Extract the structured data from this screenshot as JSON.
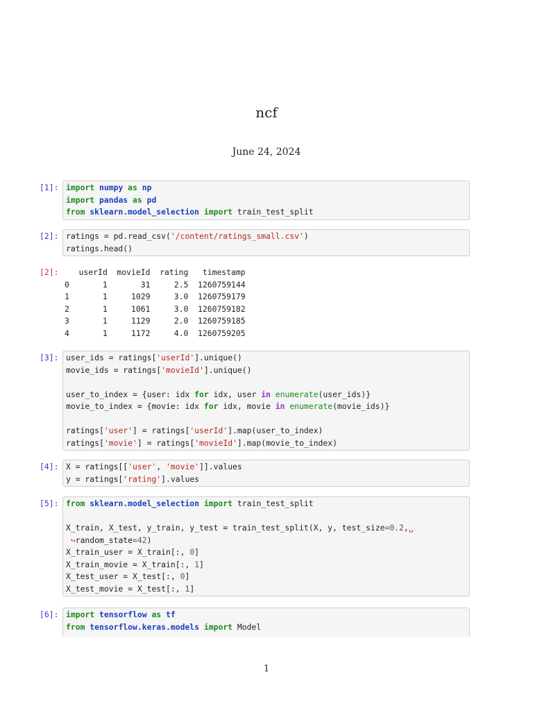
{
  "document": {
    "title": "ncf",
    "date": "June 24, 2024",
    "page_number": "1"
  },
  "cells": [
    {
      "prompt": "[1]:",
      "lines": [
        [
          [
            "import",
            "kw"
          ],
          [
            " ",
            ""
          ],
          [
            "numpy",
            "nn"
          ],
          [
            " ",
            ""
          ],
          [
            "as",
            "kw"
          ],
          [
            " ",
            ""
          ],
          [
            "np",
            "nn"
          ]
        ],
        [
          [
            "import",
            "kw"
          ],
          [
            " ",
            ""
          ],
          [
            "pandas",
            "nn"
          ],
          [
            " ",
            ""
          ],
          [
            "as",
            "kw"
          ],
          [
            " ",
            ""
          ],
          [
            "pd",
            "nn"
          ]
        ],
        [
          [
            "from",
            "kw"
          ],
          [
            " ",
            ""
          ],
          [
            "sklearn.model_selection",
            "nn"
          ],
          [
            " ",
            ""
          ],
          [
            "import",
            "kw"
          ],
          [
            " train_test_split",
            ""
          ]
        ]
      ]
    },
    {
      "prompt": "[2]:",
      "lines": [
        [
          [
            "ratings = pd.read_csv(",
            ""
          ],
          [
            "'/content/ratings_small.csv'",
            "str"
          ],
          [
            ")",
            ""
          ]
        ],
        [
          [
            "ratings.head()",
            ""
          ]
        ]
      ]
    },
    {
      "prompt": "[3]:",
      "lines": [
        [
          [
            "user_ids = ratings[",
            ""
          ],
          [
            "'userId'",
            "str"
          ],
          [
            "].unique()",
            ""
          ]
        ],
        [
          [
            "movie_ids = ratings[",
            ""
          ],
          [
            "'movieId'",
            "str"
          ],
          [
            "].unique()",
            ""
          ]
        ],
        [
          [
            "",
            ""
          ]
        ],
        [
          [
            "user_to_index = {user: idx ",
            ""
          ],
          [
            "for",
            "kw"
          ],
          [
            " idx, user ",
            ""
          ],
          [
            "in",
            "opw"
          ],
          [
            " ",
            ""
          ],
          [
            "enumerate",
            "bi"
          ],
          [
            "(user_ids)}",
            ""
          ]
        ],
        [
          [
            "movie_to_index = {movie: idx ",
            ""
          ],
          [
            "for",
            "kw"
          ],
          [
            " idx, movie ",
            ""
          ],
          [
            "in",
            "opw"
          ],
          [
            " ",
            ""
          ],
          [
            "enumerate",
            "bi"
          ],
          [
            "(movie_ids)}",
            ""
          ]
        ],
        [
          [
            "",
            ""
          ]
        ],
        [
          [
            "ratings[",
            ""
          ],
          [
            "'user'",
            "str"
          ],
          [
            "] = ratings[",
            ""
          ],
          [
            "'userId'",
            "str"
          ],
          [
            "].map(user_to_index)",
            ""
          ]
        ],
        [
          [
            "ratings[",
            ""
          ],
          [
            "'movie'",
            "str"
          ],
          [
            "] = ratings[",
            ""
          ],
          [
            "'movieId'",
            "str"
          ],
          [
            "].map(movie_to_index)",
            ""
          ]
        ]
      ]
    },
    {
      "prompt": "[4]:",
      "lines": [
        [
          [
            "X = ratings[[",
            ""
          ],
          [
            "'user'",
            "str"
          ],
          [
            ", ",
            ""
          ],
          [
            "'movie'",
            "str"
          ],
          [
            "]].values",
            ""
          ]
        ],
        [
          [
            "y = ratings[",
            ""
          ],
          [
            "'rating'",
            "str"
          ],
          [
            "].values",
            ""
          ]
        ]
      ]
    },
    {
      "prompt": "[5]:",
      "lines": [
        [
          [
            "from",
            "kw"
          ],
          [
            " ",
            ""
          ],
          [
            "sklearn.model_selection",
            "nn"
          ],
          [
            " ",
            ""
          ],
          [
            "import",
            "kw"
          ],
          [
            " train_test_split",
            ""
          ]
        ],
        [
          [
            "",
            ""
          ]
        ],
        [
          [
            "X_train, X_test, y_train, y_test = train_test_split(X, y, test_size",
            ""
          ],
          [
            "=",
            "num"
          ],
          [
            "0.2",
            "num"
          ],
          [
            ",",
            ""
          ],
          [
            "␣",
            "cont"
          ]
        ],
        [
          [
            " ",
            ""
          ],
          [
            "↪",
            "cont"
          ],
          [
            "random_state",
            ""
          ],
          [
            "=",
            "num"
          ],
          [
            "42",
            "num"
          ],
          [
            ")",
            ""
          ]
        ],
        [
          [
            "X_train_user = X_train[:, ",
            ""
          ],
          [
            "0",
            "num"
          ],
          [
            "]",
            ""
          ]
        ],
        [
          [
            "X_train_movie = X_train[:, ",
            ""
          ],
          [
            "1",
            "num"
          ],
          [
            "]",
            ""
          ]
        ],
        [
          [
            "X_test_user = X_test[:, ",
            ""
          ],
          [
            "0",
            "num"
          ],
          [
            "]",
            ""
          ]
        ],
        [
          [
            "X_test_movie = X_test[:, ",
            ""
          ],
          [
            "1",
            "num"
          ],
          [
            "]",
            ""
          ]
        ]
      ]
    },
    {
      "prompt": "[6]:",
      "lines": [
        [
          [
            "import",
            "kw"
          ],
          [
            " ",
            ""
          ],
          [
            "tensorflow",
            "nn"
          ],
          [
            " ",
            ""
          ],
          [
            "as",
            "kw"
          ],
          [
            " ",
            ""
          ],
          [
            "tf",
            "nn"
          ]
        ],
        [
          [
            "from",
            "kw"
          ],
          [
            " ",
            ""
          ],
          [
            "tensorflow.keras.models",
            "nn"
          ],
          [
            " ",
            ""
          ],
          [
            "import",
            "kw"
          ],
          [
            " Model",
            ""
          ]
        ]
      ]
    }
  ],
  "output_2": {
    "prompt": "[2]:",
    "lines": [
      "   userId  movieId  rating   timestamp",
      "0       1       31     2.5  1260759144",
      "1       1     1029     3.0  1260759179",
      "2       1     1061     3.0  1260759182",
      "3       1     1129     2.0  1260759185",
      "4       1     1172     4.0  1260759205"
    ]
  },
  "colors": {
    "keyword": "#1a8a1a",
    "name": "#1a3fbf",
    "string": "#b8261f",
    "in_prompt": "#2f3fbf",
    "out_prompt": "#c4382d",
    "cell_bg": "#f5f5f5"
  }
}
